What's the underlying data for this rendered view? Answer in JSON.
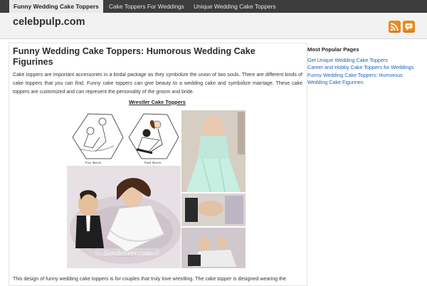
{
  "nav": {
    "items": [
      {
        "label": "Funny Wedding Cake Toppers",
        "active": true
      },
      {
        "label": "Cake Toppers For Weddings"
      },
      {
        "label": "Unique Wedding Cake Toppers"
      }
    ]
  },
  "header": {
    "site_title": "celebpulp.com",
    "icons": [
      "rss-feed-icon",
      "comments-feed-icon"
    ],
    "accent_color": "#ea8a1c"
  },
  "post": {
    "title": "Funny Wedding Cake Toppers: Humorous Wedding Cake Figurines",
    "intro": "Cake toppers are important accessories in a bridal package as they symbolize the union of two souls. There are different kinds of cake toppers that you can find. Funny cake toppers can give beauty to a wedding cake and symbolize marriage. These cake toppers are customized and can represent the personality of the groom and bride.",
    "image_caption": "Wrestler Cake Toppers",
    "figure": {
      "sketch_labels": [
        "First Sketch",
        "Final Sketch"
      ],
      "watermark": "Sandeliver.com"
    },
    "bottom_text": "This design of funny wedding cake toppers is for couples that truly love wrestling. The cake topper is designed wearing the"
  },
  "sidebar": {
    "title": "Most Popular Pages",
    "links": [
      "Get Unique Wedding Cake Toppers",
      "Career and Hobby Cake Toppers for Weddings",
      "Funny Wedding Cake Toppers: Humorous Wedding Cake Figurines"
    ],
    "link_color": "#1f63b5"
  }
}
